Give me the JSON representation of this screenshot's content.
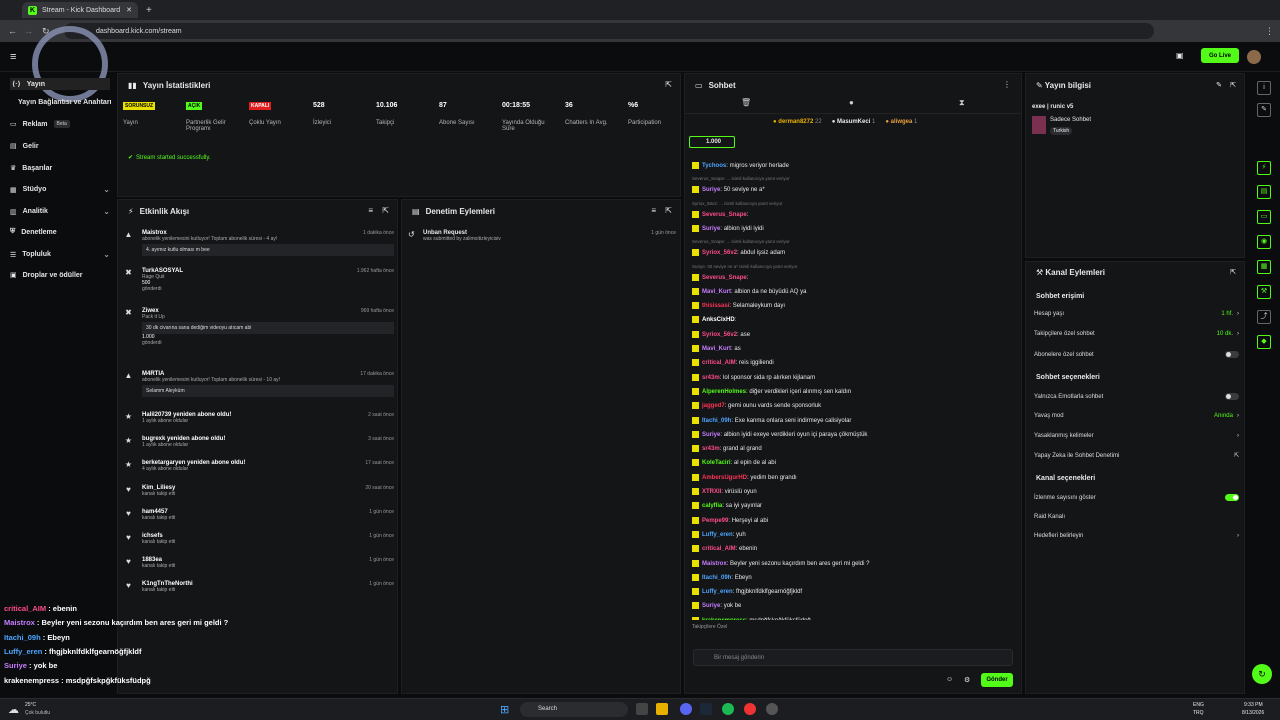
{
  "browser": {
    "tab_title": "Stream - Kick Dashboard",
    "url": "dashboard.kick.com/stream"
  },
  "topbar": {
    "go_live": "Go Live"
  },
  "sidebar": {
    "items": [
      {
        "label": "Yayın"
      },
      {
        "label": "Yayın Bağlantısı ve Anahtarı"
      },
      {
        "label": "Reklam",
        "badge": "Beta"
      },
      {
        "label": "Gelir"
      },
      {
        "label": "Başarılar"
      },
      {
        "label": "Stüdyo"
      },
      {
        "label": "Analitik"
      },
      {
        "label": "Denetleme"
      },
      {
        "label": "Topluluk"
      },
      {
        "label": "Droplar ve ödüller"
      }
    ]
  },
  "stats": {
    "title": "Yayın İstatistikleri",
    "items": [
      {
        "value": "SORUNSUZ",
        "label": "Yayın"
      },
      {
        "value": "AÇIK",
        "label": "Partnerlik Gelir Programı"
      },
      {
        "value": "KAPALI",
        "label": "Çoklu Yayın"
      },
      {
        "value": "528",
        "label": "İzleyici"
      },
      {
        "value": "10.106",
        "label": "Takipçi"
      },
      {
        "value": "87",
        "label": "Abone Sayısı"
      },
      {
        "value": "00:18:55",
        "label": "Yayında Olduğu Süre"
      },
      {
        "value": "36",
        "label": "Chatters In Avg."
      },
      {
        "value": "%6",
        "label": "Participation"
      }
    ],
    "status": "Stream started successfully."
  },
  "activity": {
    "title": "Etkinlik Akışı",
    "items": [
      {
        "name": "Maistrox",
        "sub": "abonelik yenilemesini kutluyor! Toplam abonelik süresi - 4 ay!",
        "time": "1 dakika önce",
        "quote": "4. ayımız kutlu olması m bee"
      },
      {
        "name": "TurkASOSYAL",
        "sub": "Rage Quit",
        "extra": "500",
        "extra2": "gönderdi",
        "time": "1.962 hafta önce"
      },
      {
        "name": "Ziwex",
        "sub": "Pack it Up",
        "time": "969 hafta önce",
        "quote": "30 dk civarına sana dediğim videoyu atıcam abi",
        "extra": "1.000",
        "extra2": "gönderdi"
      },
      {
        "name": "M4RTIA",
        "sub": "abonelik yenilemesini kutluyor! Toplam abonelik süresi - 10 ay!",
        "time": "17 dakika önce",
        "quote": "Selamm Aleyküm"
      },
      {
        "name": "Halil20739 yeniden abone oldu!",
        "sub": "1 aylık abone oldular",
        "time": "2 saat önce"
      },
      {
        "name": "bugrexk yeniden abone oldu!",
        "sub": "1 aylık abone oldular",
        "time": "3 saat önce"
      },
      {
        "name": "berketargaryen yeniden abone oldu!",
        "sub": "4 aylık abone oldular",
        "time": "17 saat önce"
      },
      {
        "name": "Kim_Liliesy",
        "sub": "kanalı takip etti",
        "time": "20 saat önce"
      },
      {
        "name": "ham4457",
        "sub": "kanalı takip etti",
        "time": "1 gün önce"
      },
      {
        "name": "ichsefs",
        "sub": "kanalı takip etti",
        "time": "1 gün önce"
      },
      {
        "name": "1883ea",
        "sub": "kanalı takip etti",
        "time": "1 gün önce"
      },
      {
        "name": "K1ngTnTheNorthi",
        "sub": "kanalı takip etti",
        "time": "1 gün önce"
      }
    ]
  },
  "moderation": {
    "title": "Denetim Eylemleri",
    "item": "Unban Request",
    "sub": "was submitted by zalimoitizleyicisiv",
    "time": "1 gün önce"
  },
  "chat": {
    "title": "Sohbet",
    "top": [
      {
        "name": "derman8272",
        "n": "22"
      },
      {
        "name": "MasumKeci",
        "n": "1"
      },
      {
        "name": "aliwgea",
        "n": "1"
      }
    ],
    "goal": "1.000",
    "lines": [
      {
        "u": "Tychoos",
        "t": "migros veriyor herlade",
        "c": "#4ea5ff"
      },
      {
        "r": "Severus_Snape: ... isimli kullanıcıya yanıt veriyor"
      },
      {
        "u": "Suriye",
        "t": "50 seviye ne a*",
        "c": "#c77dff"
      },
      {
        "r": "Syriox_56v2: ... isimli kullanıcıya yanıt veriyor"
      },
      {
        "u": "Severus_Snape",
        "t": "",
        "c": "#ff4d88"
      },
      {
        "u": "Suriye",
        "t": "albion iyidi iyidi",
        "c": "#c77dff"
      },
      {
        "r": "Severus_Snape: ... isimli kullanıcıya yanıt veriyor"
      },
      {
        "u": "Syriox_56v2",
        "t": "abdul işsiz adam",
        "c": "#ff4d88"
      },
      {
        "r": "Suriye: 30 seviye ne a* isimli kullanıcıya yanıt veriyor"
      },
      {
        "u": "Severus_Snape",
        "t": "",
        "c": "#ff4d88"
      },
      {
        "u": "Mavi_Kurt",
        "t": "albion da ne büyüdü AQ ya",
        "c": "#c77dff"
      },
      {
        "u": "thisissasi",
        "t": "Selamaleykum dayı",
        "c": "#ff3355"
      },
      {
        "u": "AnksCixHD",
        "t": "",
        "c": "#fff"
      },
      {
        "u": "Syriox_56v2",
        "t": "ase",
        "c": "#ff4d88"
      },
      {
        "u": "Mavi_Kurt",
        "t": "as",
        "c": "#c77dff"
      },
      {
        "u": "critical_AIM",
        "t": "reis iggiliendi",
        "c": "#ff4d88"
      },
      {
        "u": "sr43m",
        "t": "lol sponsor sida rp alırken kijlanam",
        "c": "#ff4d88"
      },
      {
        "u": "AlperenHolmes",
        "t": "diğer verdikleri içeri alınmış sen kaldın",
        "c": "#53fc18"
      },
      {
        "u": "jagged7",
        "t": "gemi ounu vards sende sponsorluk",
        "c": "#ff3355"
      },
      {
        "u": "Itachi_09h",
        "t": "Exe kanma onlara seni indirmeye calisiyolar",
        "c": "#4ea5ff"
      },
      {
        "u": "Suriye",
        "t": "albion iyidi exeye verdikleri oyun içi paraya çökmüştük",
        "c": "#c77dff"
      },
      {
        "u": "sr43m",
        "t": "grand al grand",
        "c": "#ff4d88"
      },
      {
        "u": "KoleTaciri",
        "t": "al epin de al abi",
        "c": "#53fc18"
      },
      {
        "u": "AmbersUgurHD",
        "t": "yedim ben grandı",
        "c": "#ff3355"
      },
      {
        "u": "XTRXII",
        "t": "virüslü oyun",
        "c": "#ff4d88"
      },
      {
        "u": "calyflia",
        "t": "sa iyi yayınlar",
        "c": "#53fc18"
      },
      {
        "u": "Pempe99",
        "t": "Herşeyi al abi",
        "c": "#ff4d88"
      },
      {
        "u": "Luffy_eren",
        "t": "yuh",
        "c": "#4ea5ff"
      },
      {
        "u": "critical_AIM",
        "t": "ebenin",
        "c": "#ff4d88"
      },
      {
        "u": "Maistrox",
        "t": "Beyler yeni sezonu kaçırdım ben ares geri mi geldi ?",
        "c": "#c77dff"
      },
      {
        "u": "Itachi_09h",
        "t": "Ebeyn",
        "c": "#4ea5ff"
      },
      {
        "u": "Luffy_eren",
        "t": "fhgjbknlfdklfgearnöğfjkldf",
        "c": "#4ea5ff"
      },
      {
        "u": "Suriye",
        "t": "yok be",
        "c": "#c77dff"
      },
      {
        "u": "krakenempress",
        "t": "msdpğfskpğkfüksfüdpğ",
        "c": "#53fc18"
      }
    ],
    "followers_only": "Takipçilere Özel",
    "placeholder": "Bir mesaj gönderin",
    "send": "Gönder"
  },
  "info": {
    "title": "Yayın bilgisi",
    "stream_title": "exee | runic v5",
    "mode": "Sadece Sohbet",
    "lang": "Turkish"
  },
  "channel_actions": {
    "title": "Kanal Eylemleri",
    "chat_access": "Sohbet erişimi",
    "access": [
      {
        "label": "Hesap yaşı",
        "value": "1 hf."
      },
      {
        "label": "Takipçilere özel sohbet",
        "value": "10 dk."
      },
      {
        "label": "Abonelere özel sohbet",
        "value": ""
      }
    ],
    "chat_options": "Sohbet seçenekleri",
    "options": [
      {
        "label": "Yalnızca Emotlarla sohbet",
        "value": ""
      },
      {
        "label": "Yavaş mod",
        "value": "Anında"
      },
      {
        "label": "Yasaklanmış kelimeler",
        "value": ""
      },
      {
        "label": "Yapay Zeka ile Sohbet Denetimi",
        "value": ""
      }
    ],
    "channel_options": "Kanal seçenekleri",
    "chan": [
      {
        "label": "İzlenme sayısını göster",
        "value": ""
      },
      {
        "label": "Raid Kanalı",
        "value": ""
      },
      {
        "label": "Hedefleri belirleyin",
        "value": ""
      }
    ]
  },
  "overlay": [
    {
      "u": "critical_AIM",
      "t": "ebenin",
      "c": "#ff4d88"
    },
    {
      "u": "Maistrox",
      "t": "Beyler yeni sezonu kaçırdım ben ares geri mi geldi ?",
      "c": "#c77dff"
    },
    {
      "u": "Itachi_09h",
      "t": "Ebeyn",
      "c": "#4ea5ff"
    },
    {
      "u": "Luffy_eren",
      "t": "fhgjbknlfdklfgearnöğfjkldf",
      "c": "#4ea5ff"
    },
    {
      "u": "Suriye",
      "t": "yok be",
      "c": "#c77dff"
    },
    {
      "u": "krakenempress",
      "t": "msdpğfskpğkfüksfüdpğ",
      "c": "#fff"
    }
  ],
  "taskbar": {
    "weather_temp": "25°C",
    "weather": "Çok bulutlu",
    "search": "Search",
    "lang1": "ENG",
    "lang2": "TRQ",
    "time": "9:33 PM",
    "date": "8/13/2026"
  }
}
